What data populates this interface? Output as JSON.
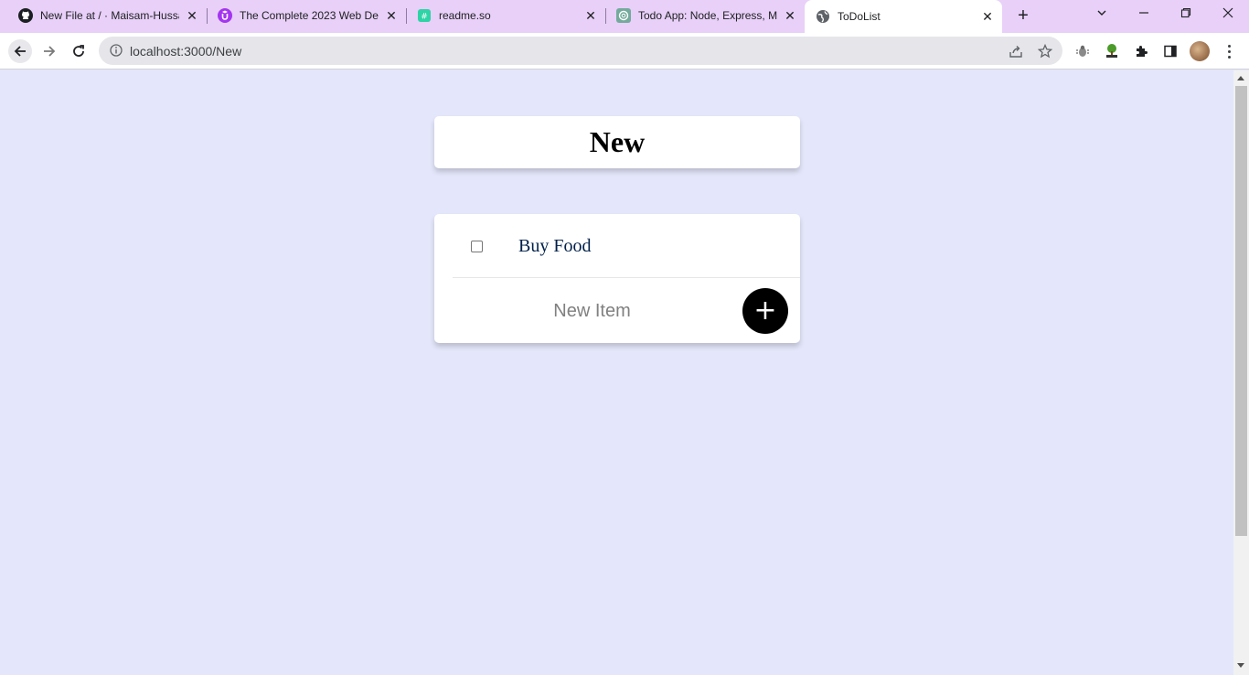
{
  "browser": {
    "tabs": [
      {
        "title": "New File at / · Maisam-Hussa",
        "icon": "github-icon"
      },
      {
        "title": "The Complete 2023 Web Dev",
        "icon": "udemy-icon"
      },
      {
        "title": "readme.so",
        "icon": "readme-icon"
      },
      {
        "title": "Todo App: Node, Express, Mo",
        "icon": "chatgpt-icon"
      },
      {
        "title": "ToDoList",
        "icon": "globe-icon",
        "active": true
      }
    ],
    "new_tab": "+",
    "url": "localhost:3000/New"
  },
  "page": {
    "heading": "New",
    "items": [
      {
        "text": "Buy Food",
        "checked": false
      }
    ],
    "new_item_placeholder": "New Item",
    "add_button": "+"
  },
  "colors": {
    "background": "#E4E7FB",
    "tabstrip": "#E8D0F8",
    "item_text": "#00204A"
  }
}
